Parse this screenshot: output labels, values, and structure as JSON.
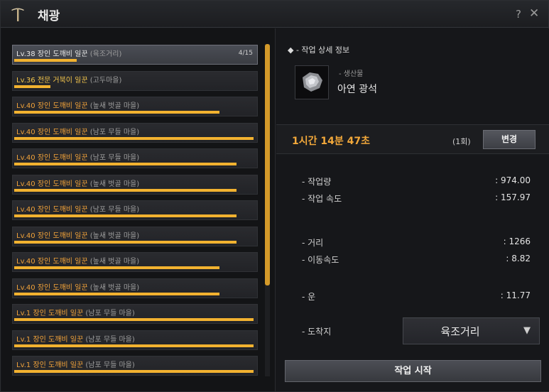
{
  "window": {
    "title": "채광",
    "help_label": "?",
    "close_label": "✕",
    "title_icon": "pickaxe-icon"
  },
  "workers": [
    {
      "level": "Lv.38",
      "name": "장인 도깨비 일꾼",
      "town": "(육조거리)",
      "count": "4/15",
      "progress": 0.26,
      "level_color": "#e9e9e9",
      "selected": true
    },
    {
      "level": "Lv.36",
      "name": "전문 거북이 일꾼",
      "town": "(고두마을)",
      "count": "",
      "progress": 0.15,
      "level_color": "#f4c64c",
      "selected": false
    },
    {
      "level": "Lv.40",
      "name": "장인 도깨비 일꾼",
      "town": "(높새 벗골 마을)",
      "count": "",
      "progress": 0.85,
      "level_color": "#f0a23a",
      "selected": false
    },
    {
      "level": "Lv.40",
      "name": "장인 도깨비 일꾼",
      "town": "(남포 무들 마을)",
      "count": "",
      "progress": 0.99,
      "level_color": "#f0a23a",
      "selected": false
    },
    {
      "level": "Lv.40",
      "name": "장인 도깨비 일꾼",
      "town": "(남포 무들 마을)",
      "count": "",
      "progress": 0.92,
      "level_color": "#f0a23a",
      "selected": false
    },
    {
      "level": "Lv.40",
      "name": "장인 도깨비 일꾼",
      "town": "(높새 벗골 마을)",
      "count": "",
      "progress": 0.92,
      "level_color": "#f0a23a",
      "selected": false
    },
    {
      "level": "Lv.40",
      "name": "장인 도깨비 일꾼",
      "town": "(남포 무들 마을)",
      "count": "",
      "progress": 0.92,
      "level_color": "#f0a23a",
      "selected": false
    },
    {
      "level": "Lv.40",
      "name": "장인 도깨비 일꾼",
      "town": "(높새 벗골 마을)",
      "count": "",
      "progress": 0.92,
      "level_color": "#f0a23a",
      "selected": false
    },
    {
      "level": "Lv.40",
      "name": "장인 도깨비 일꾼",
      "town": "(높새 벗골 마을)",
      "count": "",
      "progress": 0.85,
      "level_color": "#f0a23a",
      "selected": false
    },
    {
      "level": "Lv.40",
      "name": "장인 도깨비 일꾼",
      "town": "(높새 벗골 마을)",
      "count": "",
      "progress": 0.85,
      "level_color": "#f0a23a",
      "selected": false
    },
    {
      "level": "Lv.1",
      "name": "장인 도깨비 일꾼",
      "town": "(남포 무들 마을)",
      "count": "",
      "progress": 0.99,
      "level_color": "#f0a23a",
      "selected": false
    },
    {
      "level": "Lv.1",
      "name": "장인 도깨비 일꾼",
      "town": "(남포 무들 마을)",
      "count": "",
      "progress": 0.99,
      "level_color": "#f0a23a",
      "selected": false
    },
    {
      "level": "Lv.1",
      "name": "장인 도깨비 일꾼",
      "town": "(남포 무들 마을)",
      "count": "",
      "progress": 0.99,
      "level_color": "#f0a23a",
      "selected": false
    }
  ],
  "detail": {
    "section_title": "- 작업 상세 정보",
    "section_bullet": "◆",
    "product_label": "- 생산물",
    "product_name": "아연 광석",
    "product_icon": "zinc-ore-icon",
    "time": "1시간 14분 47초",
    "count": "(1회)",
    "change_label": "변경",
    "stats": {
      "work_amount_label": "- 작업량",
      "work_amount_value": ": 974.00",
      "work_speed_label": "- 작업 속도",
      "work_speed_value": ": 157.97",
      "distance_label": "- 거리",
      "distance_value": ": 1266",
      "move_speed_label": "- 이동속도",
      "move_speed_value": ": 8.82",
      "luck_label": "- 운",
      "luck_value": ": 11.77",
      "destination_label": "- 도착지"
    },
    "destination_value": "육조거리",
    "destination_caret": "▼",
    "start_label": "작업 시작"
  },
  "colors": {
    "accent": "#f2b230",
    "time": "#f2a83a"
  }
}
